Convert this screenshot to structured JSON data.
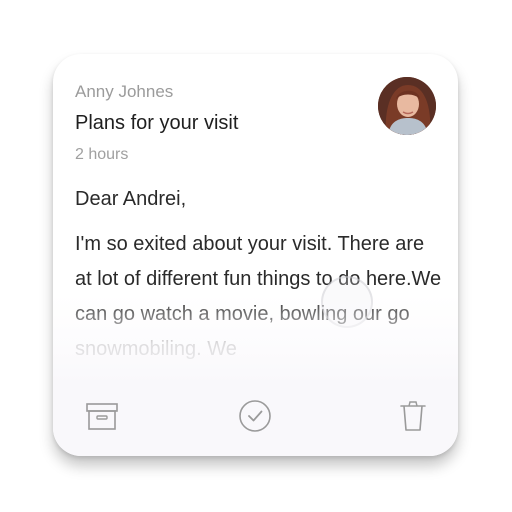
{
  "email": {
    "sender": "Anny Johnes",
    "subject": "Plans for your visit",
    "time": "2 hours",
    "greeting": "Dear Andrei,",
    "message": "I'm so exited about your visit. There are at lot of different fun things to do here.We can go watch a movie, bowling our go snowmobiling. We"
  },
  "actions": {
    "archive_icon": "archive-box-icon",
    "done_icon": "check-circle-icon",
    "delete_icon": "trash-icon"
  },
  "colors": {
    "card_background": "#ffffff",
    "footer_background": "#f9f8fb",
    "icon_stroke": "#9a9a9a",
    "muted_text": "#9b9b9b",
    "primary_text": "#1f1f1f"
  }
}
